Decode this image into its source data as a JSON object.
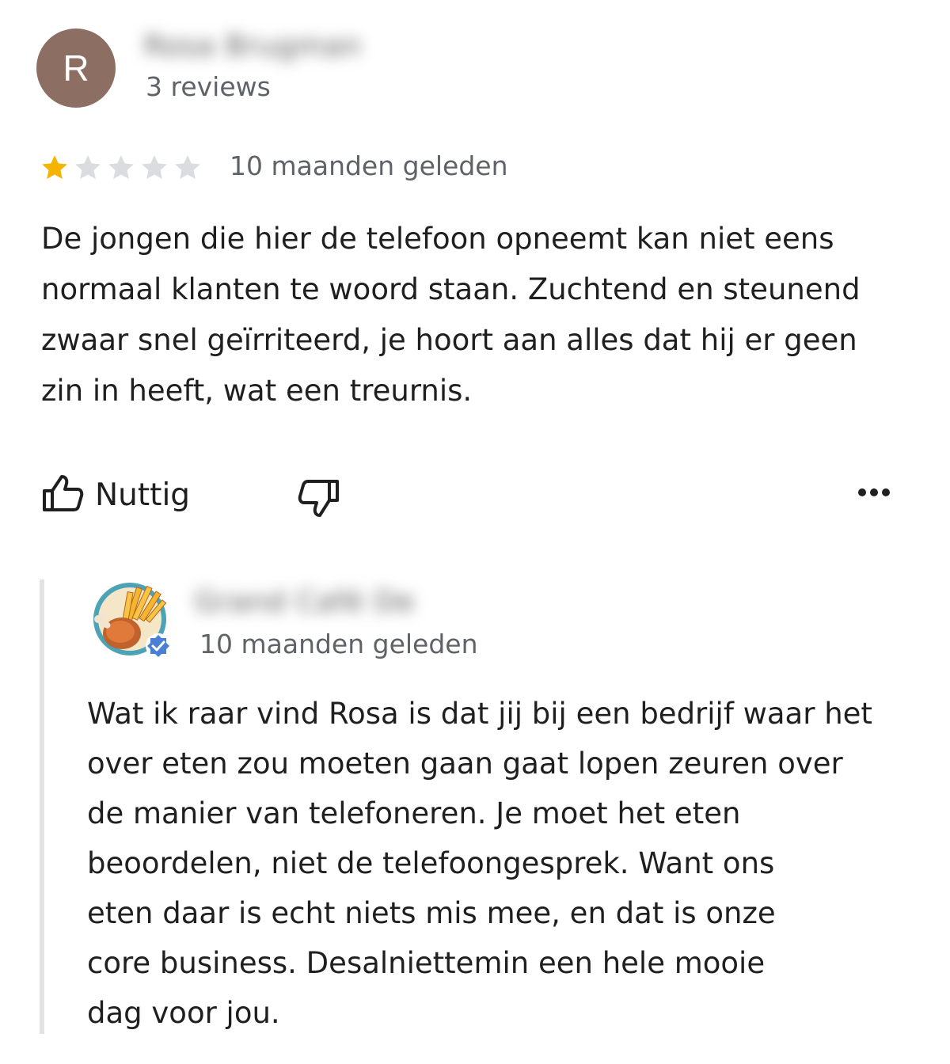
{
  "review": {
    "avatar_letter": "R",
    "avatar_color": "#8d6e63",
    "reviewer_name": "Rosa Brugman",
    "review_count": "3 reviews",
    "rating": 1,
    "rating_max": 5,
    "star_filled_color": "#f4b400",
    "star_empty_color": "#dadce0",
    "time": "10 maanden geleden",
    "text": "De jongen die hier de telefoon opneemt kan niet eens normaal klanten te woord staan. Zuchtend en steunend zwaar snel geïrriteerd, je hoort aan alles dat hij er geen zin in heeft, wat een treurnis."
  },
  "actions": {
    "helpful_label": "Nuttig",
    "helpful_icon": "thumbs-up-icon",
    "not_helpful_icon": "thumbs-down-icon",
    "more_icon": "more-horizontal-icon"
  },
  "owner_reply": {
    "owner_name": "Grand Café De",
    "verified_badge_color": "#4a80d4",
    "time": "10 maanden geleden",
    "lines": [
      "Wat ik raar vind Rosa is dat jij bij een bedrijf waar het",
      "over eten zou moeten gaan gaat lopen zeuren over",
      "de manier van telefoneren. Je moet het eten",
      "beoordelen, niet de telefoongesprek. Want ons",
      "eten daar is echt niets mis mee, en dat is onze",
      "core business. Desalniettemin een hele mooie",
      "dag voor jou."
    ]
  }
}
